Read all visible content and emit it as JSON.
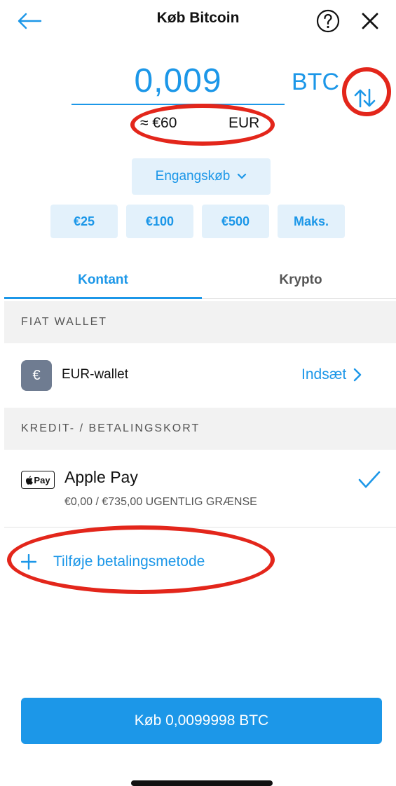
{
  "header": {
    "title": "Køb Bitcoin",
    "back_icon": "arrow-left-icon",
    "help_icon": "question-circle-icon",
    "close_icon": "close-icon"
  },
  "amount": {
    "value": "0,009",
    "currency": "BTC",
    "fiat_approx": "≈ €60",
    "fiat_currency": "EUR",
    "swap_icon": "swap-arrows-icon"
  },
  "frequency": {
    "label": "Engangskøb"
  },
  "quick_amounts": [
    "€25",
    "€100",
    "€500",
    "Maks."
  ],
  "tabs": {
    "cash": "Kontant",
    "crypto": "Krypto"
  },
  "sections": {
    "fiat_wallet": "FIAT WALLET",
    "cards": "KREDIT- / BETALINGSKORT"
  },
  "wallet": {
    "icon_symbol": "€",
    "name": "EUR-wallet",
    "action": "Indsæt"
  },
  "apple_pay": {
    "logo_text": "Pay",
    "name": "Apple Pay",
    "limit": "€0,00 / €735,00 UGENTLIG GRÆNSE"
  },
  "add_method": {
    "label": "Tilføje betalingsmetode"
  },
  "buy_button": {
    "label": "Køb 0,0099998 BTC"
  },
  "colors": {
    "accent": "#1c97e8",
    "chip_bg": "#e3f1fb",
    "annotation_red": "#e3261b",
    "section_bg": "#f2f2f2"
  }
}
